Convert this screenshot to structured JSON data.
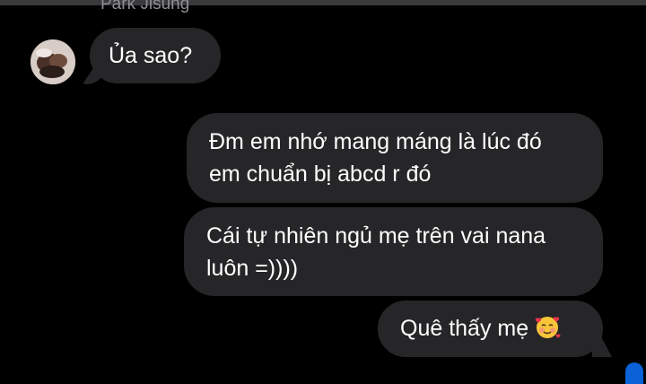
{
  "chat": {
    "sender_name": "Park Jisung",
    "incoming": {
      "text": "Ủa sao?"
    },
    "outgoing": [
      {
        "lines": [
          "Đm em nhớ mang máng là lúc đó",
          "em chuẩn bị abcd r đó"
        ]
      },
      {
        "lines": [
          "Cái tự nhiên ngủ mẹ trên vai nana",
          "luôn =))))"
        ]
      },
      {
        "text": "Quê thấy mẹ",
        "emoji": "smiling-face-with-hearts"
      }
    ]
  },
  "colors": {
    "background": "#000000",
    "bubble": "#262628",
    "text": "#ffffff",
    "sender_name": "#8e8e93",
    "accent": "#0a62d6"
  }
}
